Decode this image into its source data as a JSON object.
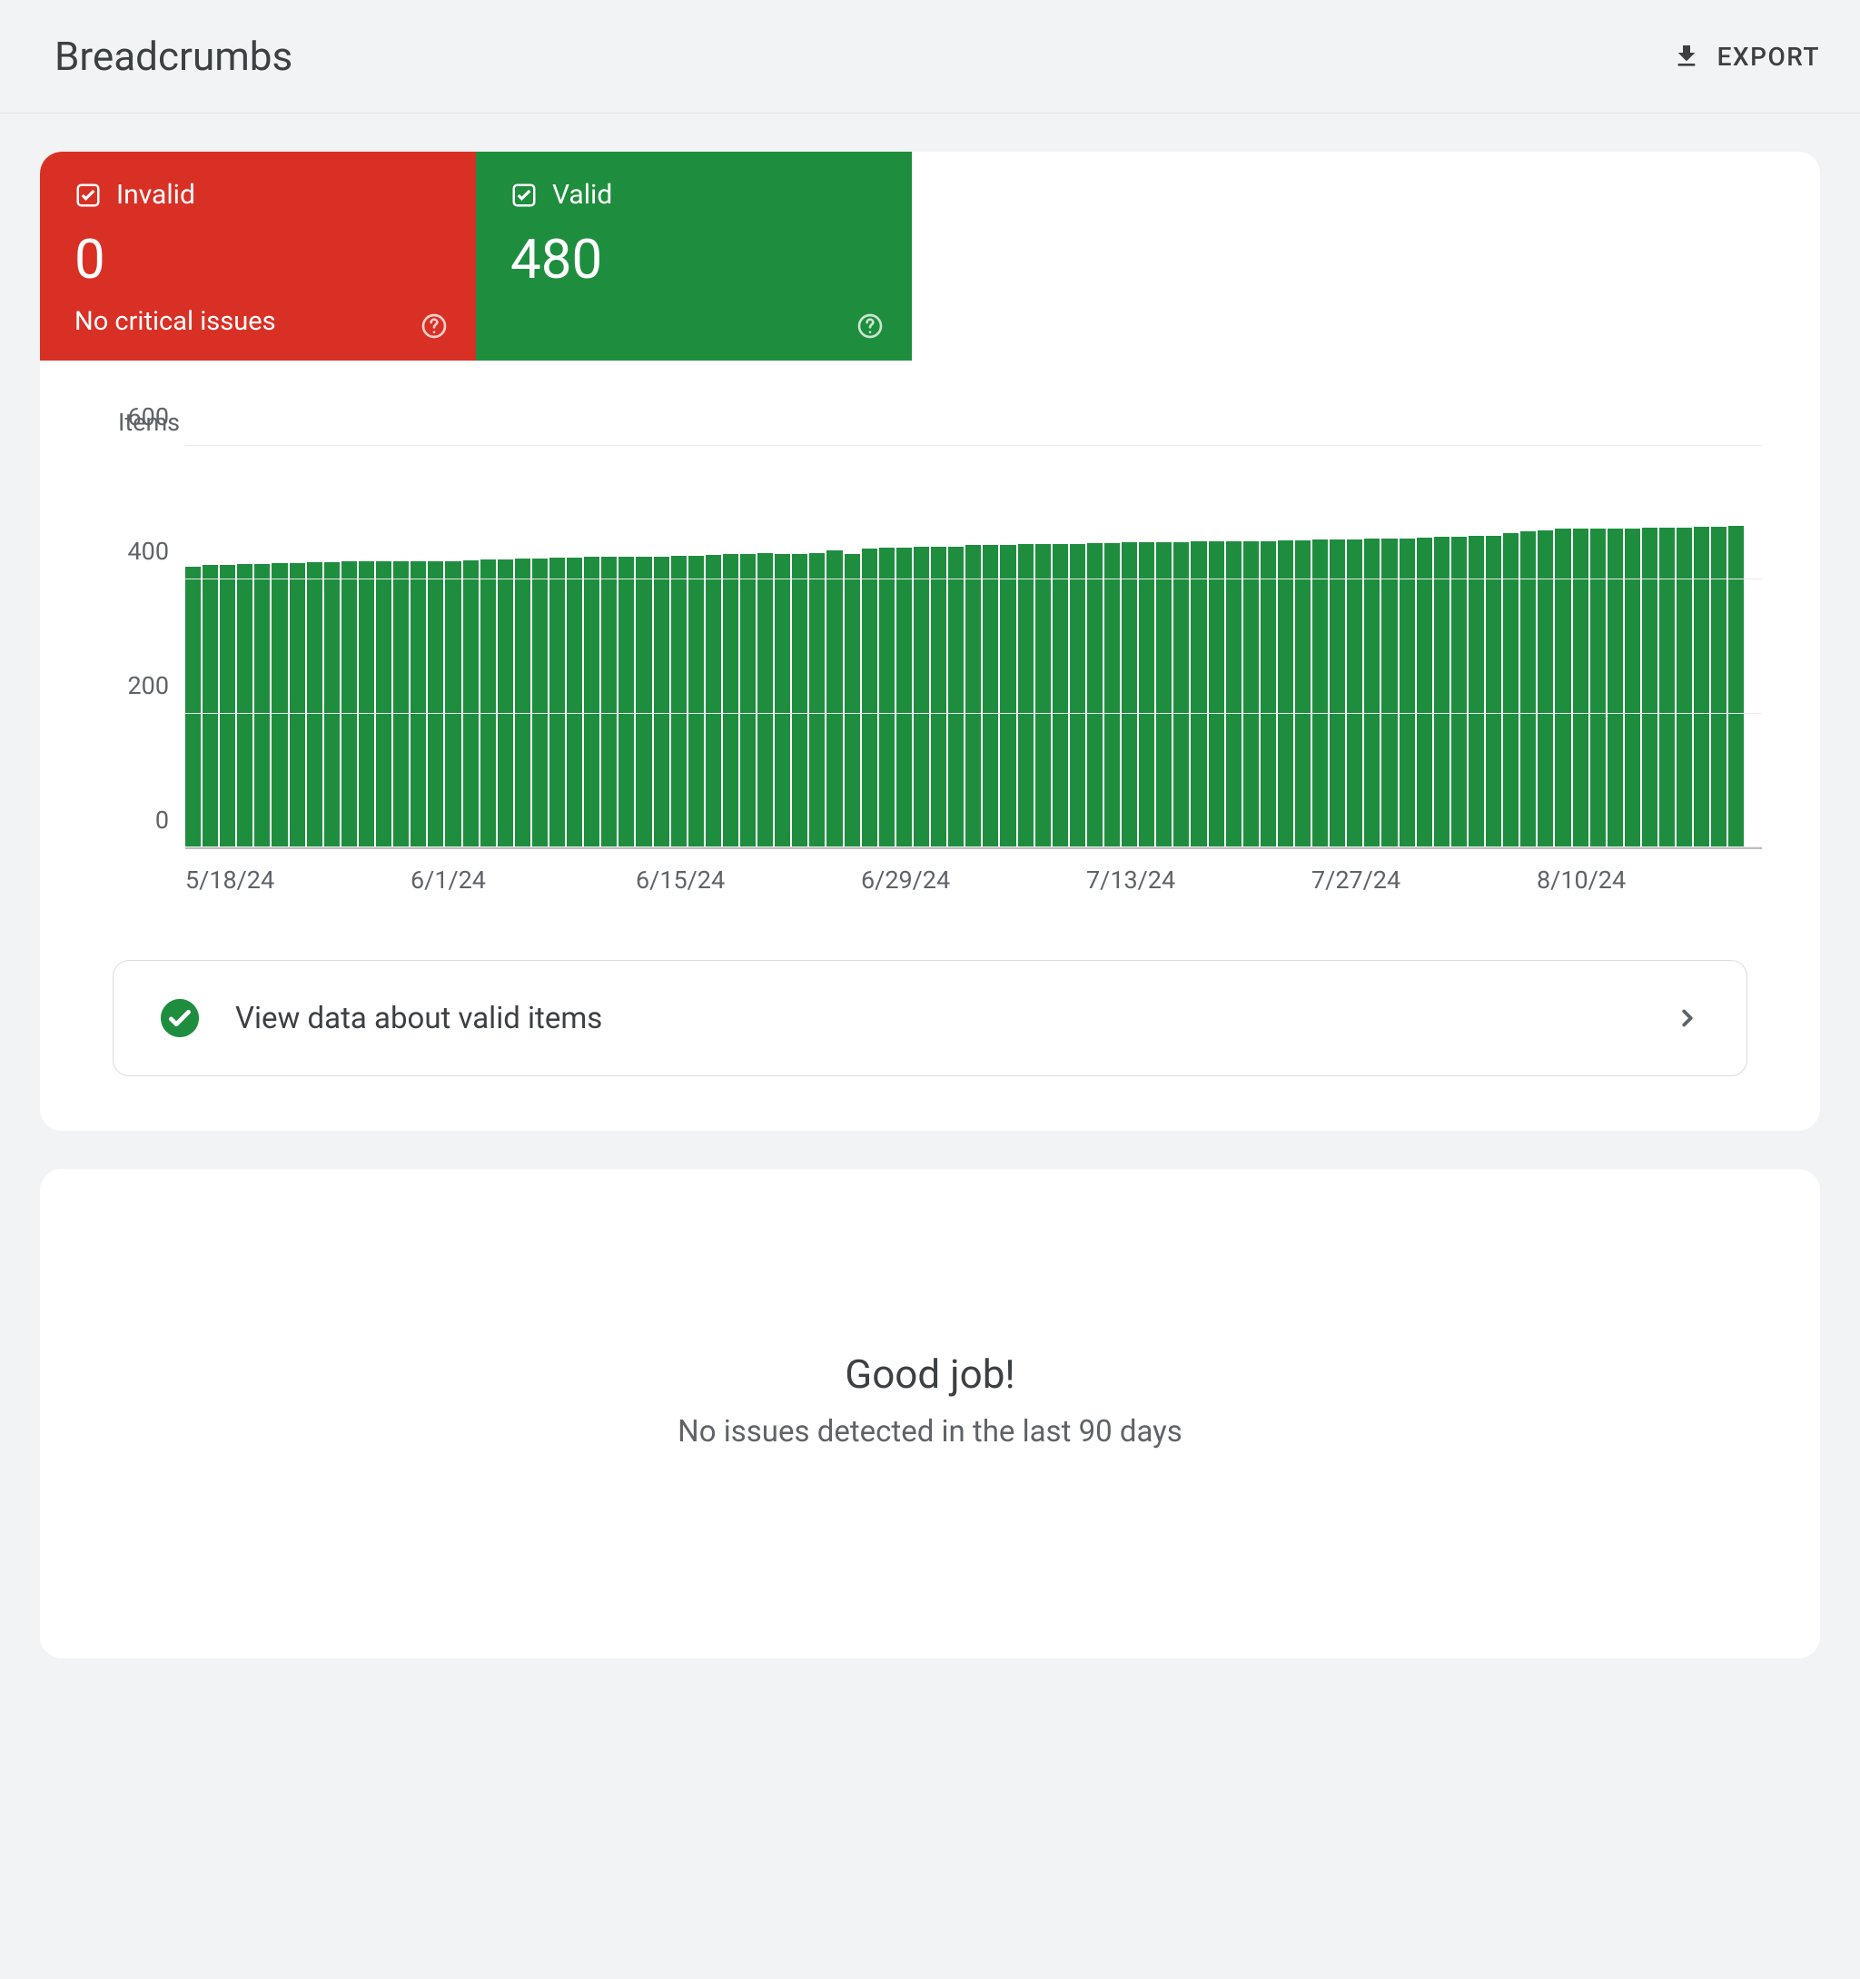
{
  "header": {
    "title": "Breadcrumbs",
    "export_label": "EXPORT"
  },
  "tiles": {
    "invalid": {
      "label": "Invalid",
      "count": "0",
      "subtitle": "No critical issues"
    },
    "valid": {
      "label": "Valid",
      "count": "480"
    }
  },
  "valid_link": {
    "label": "View data about valid items"
  },
  "goodjob": {
    "title": "Good job!",
    "subtitle": "No issues detected in the last 90 days"
  },
  "colors": {
    "invalid": "#d93025",
    "valid": "#1e8e3e"
  },
  "chart_data": {
    "type": "bar",
    "title": "Items",
    "ylabel": "Items",
    "xlabel": "",
    "ylim": [
      0,
      600
    ],
    "yticks": [
      0,
      200,
      400,
      600
    ],
    "xticks": [
      "5/18/24",
      "6/1/24",
      "6/15/24",
      "6/29/24",
      "7/13/24",
      "7/27/24",
      "8/10/24"
    ],
    "series": [
      {
        "name": "Valid",
        "color": "#1e8e3e",
        "values": [
          420,
          422,
          422,
          424,
          424,
          425,
          425,
          426,
          426,
          427,
          427,
          428,
          428,
          428,
          428,
          428,
          429,
          430,
          430,
          432,
          432,
          433,
          433,
          434,
          434,
          434,
          435,
          435,
          436,
          436,
          437,
          438,
          438,
          440,
          438,
          438,
          440,
          444,
          438,
          446,
          448,
          448,
          450,
          450,
          450,
          452,
          452,
          452,
          453,
          453,
          454,
          454,
          455,
          455,
          456,
          456,
          456,
          456,
          457,
          457,
          458,
          458,
          458,
          459,
          459,
          460,
          460,
          460,
          461,
          462,
          462,
          463,
          464,
          464,
          465,
          466,
          470,
          472,
          474,
          476,
          476,
          476,
          477,
          477,
          478,
          478,
          478,
          479,
          479,
          480
        ]
      }
    ]
  }
}
